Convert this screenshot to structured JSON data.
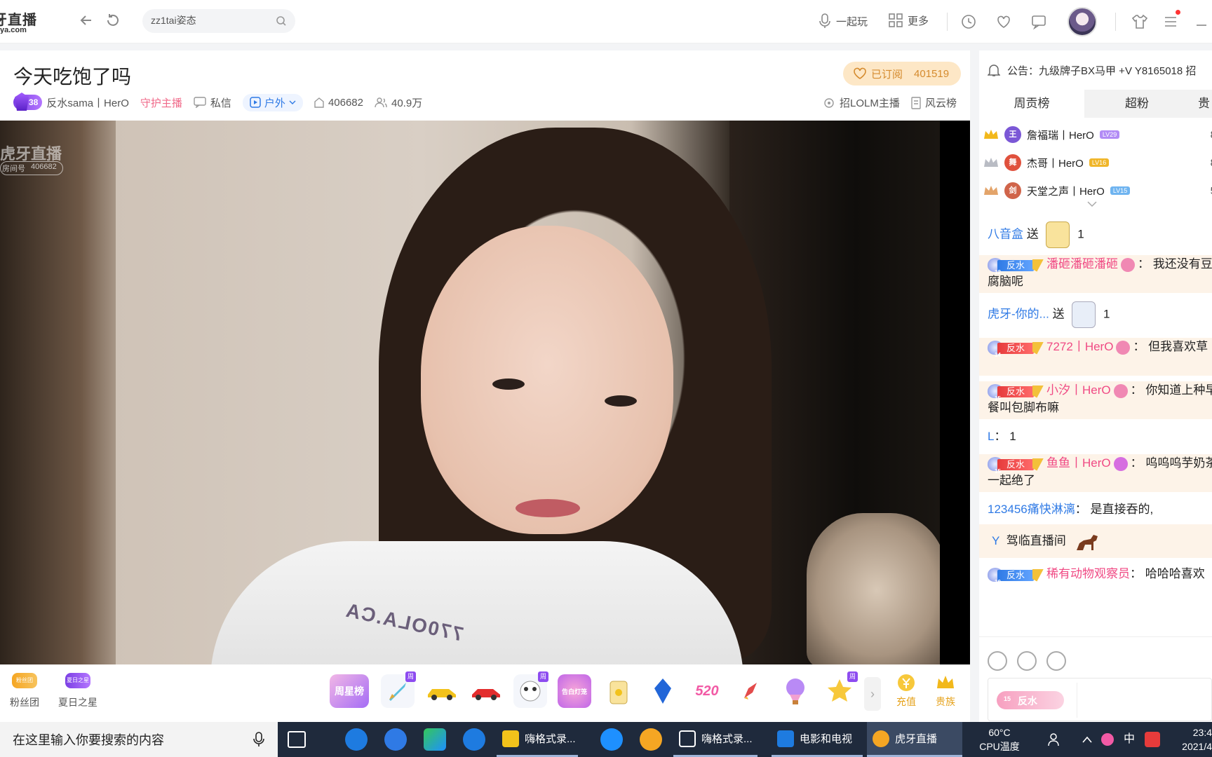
{
  "topbar": {
    "logo_main": "牙直播",
    "logo_sub": "ya.com",
    "search_value": "zz1tai姿态",
    "play_label": "一起玩",
    "more_label": "更多"
  },
  "room": {
    "title": "今天吃饱了吗",
    "level": "38",
    "anchor_name": "反水sama丨HerO",
    "guard_label": "守护主播",
    "message_label": "私信",
    "category": "户外",
    "room_id": "406682",
    "viewers": "40.9万",
    "subscribe_label": "已订阅",
    "subscribe_count": "401519",
    "recruit_label": "招LOLM主播",
    "rank_label": "风云榜"
  },
  "video": {
    "watermark": "虎牙直播",
    "watermark_room_label": "房间号",
    "watermark_room": "406682",
    "shirt_text": "770OLA.CA"
  },
  "giftbar": {
    "fans_badge": "粉丝团",
    "fans_label": "粉丝团",
    "summer_badge": "夏日之星",
    "summer_label": "夏日之星",
    "weekly_star": "周星榜",
    "week_tag": "周",
    "lamp_tag": "告白灯笼",
    "num_520": "520",
    "arrow": "›",
    "recharge_label": "充值",
    "noble_label": "贵族"
  },
  "right": {
    "notice": "公告：九级牌子BX马甲 +V    Y8165018  招",
    "tabs": [
      "周贡榜",
      "超粉",
      "贵"
    ],
    "ranks": [
      {
        "badge": "王",
        "name": "詹福瑞丨HerO",
        "lv": "LV29",
        "num": "8",
        "color": "#7b58d6",
        "lvcolor": "#b28cf5"
      },
      {
        "badge": "舞",
        "name": "杰哥丨HerO",
        "lv": "LV16",
        "num": "8",
        "color": "#e0513d",
        "lvcolor": "#f0b62a"
      },
      {
        "badge": "剑",
        "name": "天堂之声丨HerO",
        "lv": "LV15",
        "num": "5",
        "color": "#d0644a",
        "lvcolor": "#6fb4f0"
      }
    ]
  },
  "chat": {
    "gift1_user": "八音盒",
    "gift1_verb": "送",
    "gift1_count": "1",
    "m1_lv": "12",
    "m1_fan": "反水",
    "m1_user": "潘砸潘砸潘砸",
    "m1_text": "我还没有豆腐脑呢",
    "gift2_user": "虎牙-你的...",
    "gift2_verb": "送",
    "gift2_count": "1",
    "m2_lv": "14",
    "m2_fan": "反水",
    "m2_user": "7272丨HerO",
    "m2_text": "但我喜欢草",
    "m3_lv": "15",
    "m3_fan": "反水",
    "m3_user": "小汐丨HerO",
    "m3_text": "你知道上种早餐叫包脚布嘛",
    "m4_user": "L",
    "m4_text": "1",
    "m5_lv": "15",
    "m5_fan": "反水",
    "m5_user": "鱼鱼丨HerO",
    "m5_text": "呜呜呜芋奶茶一起绝了",
    "m6_user": "123456痛快淋漓",
    "m6_text": "是直接吞的,",
    "m7_user": "Y",
    "m7_text": "驾临直播间",
    "m8_lv": "10",
    "m8_fan": "反水",
    "m8_user": "稀有动物观察员",
    "m8_text": "哈哈哈喜欢",
    "input_badge_lv": "15",
    "input_badge": "反水"
  },
  "taskbar": {
    "search_text": "在这里输入你要搜索的内容",
    "app1": "嗨格式录...",
    "app2": "嗨格式录...",
    "app3": "电影和电视",
    "app4": "虎牙直播",
    "temp": "60°C",
    "temp_label": "CPU温度",
    "ime": "中",
    "time": "23:4",
    "date": "2021/4"
  }
}
